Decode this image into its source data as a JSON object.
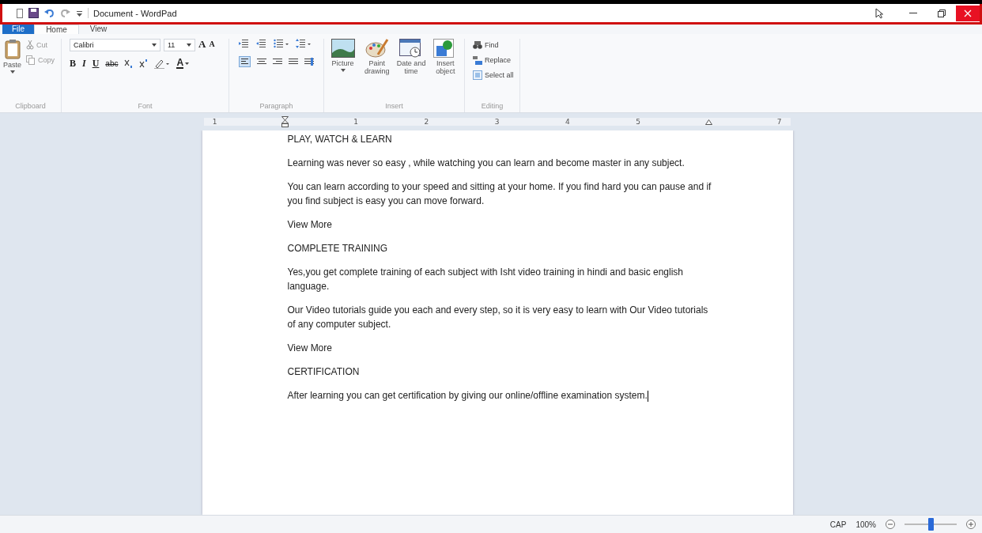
{
  "window": {
    "title": "Document - WordPad"
  },
  "tabs": [
    {
      "label": "File",
      "kind": "file",
      "selected": false
    },
    {
      "label": "Home",
      "kind": "tab",
      "selected": true
    },
    {
      "label": "View",
      "kind": "tab",
      "selected": false
    }
  ],
  "ribbon": {
    "clipboard": {
      "label": "Clipboard",
      "paste": "Paste",
      "cut": "Cut",
      "copy": "Copy"
    },
    "font": {
      "label": "Font",
      "font_name": "Calibri",
      "font_size": "11",
      "size_buttons": [
        {
          "kind": "grow",
          "label": "A"
        },
        {
          "kind": "shrink",
          "label": "A"
        }
      ],
      "format_buttons": [
        {
          "kind": "bold",
          "label": "B"
        },
        {
          "kind": "italic",
          "label": "I"
        },
        {
          "kind": "underline",
          "label": "U"
        },
        {
          "kind": "strike",
          "label": "abc"
        },
        {
          "kind": "subscript"
        },
        {
          "kind": "superscript"
        },
        {
          "kind": "highlight"
        },
        {
          "kind": "color",
          "label": "A"
        }
      ]
    },
    "paragraph": {
      "label": "Paragraph"
    },
    "insert": {
      "label": "Insert",
      "buttons": [
        {
          "kind": "picture",
          "label": "Picture",
          "dropdown": true
        },
        {
          "kind": "paint",
          "label": "Paint drawing",
          "dropdown": false
        },
        {
          "kind": "datetime",
          "label": "Date and time",
          "dropdown": false
        },
        {
          "kind": "object",
          "label": "Insert object",
          "dropdown": false
        }
      ]
    },
    "editing": {
      "label": "Editing",
      "buttons": [
        {
          "kind": "find",
          "label": "Find"
        },
        {
          "kind": "replace",
          "label": "Replace"
        },
        {
          "kind": "selectall",
          "label": "Select all"
        }
      ]
    }
  },
  "ruler": [
    {
      "kind": "label",
      "label": "1"
    },
    {
      "kind": "indent"
    },
    {
      "kind": "label",
      "label": "1"
    },
    {
      "kind": "label",
      "label": "2"
    },
    {
      "kind": "label",
      "label": "3"
    },
    {
      "kind": "label",
      "label": "4"
    },
    {
      "kind": "label",
      "label": "5"
    },
    {
      "kind": "right-indent"
    },
    {
      "kind": "label",
      "label": "7"
    }
  ],
  "document": {
    "paragraphs": [
      "PLAY, WATCH & LEARN",
      "Learning was never so easy , while watching you can learn and become master in any subject.",
      "You can learn according to your speed and sitting at your home. If you find hard you can pause and if you find subject is easy you can move forward.",
      "View More",
      "COMPLETE TRAINING",
      "Yes,you get complete training of each subject with Isht video training in hindi and basic english language.",
      "Our Video tutorials guide you each and every step, so it is very easy to learn with Our Video tutorials of any computer subject.",
      "View More",
      "CERTIFICATION",
      "After learning you can get certification by giving our online/offline examination system."
    ]
  },
  "status_bar": {
    "caps": "CAP",
    "zoom": "100%",
    "zoom_slider": {
      "level": 0.5
    }
  }
}
